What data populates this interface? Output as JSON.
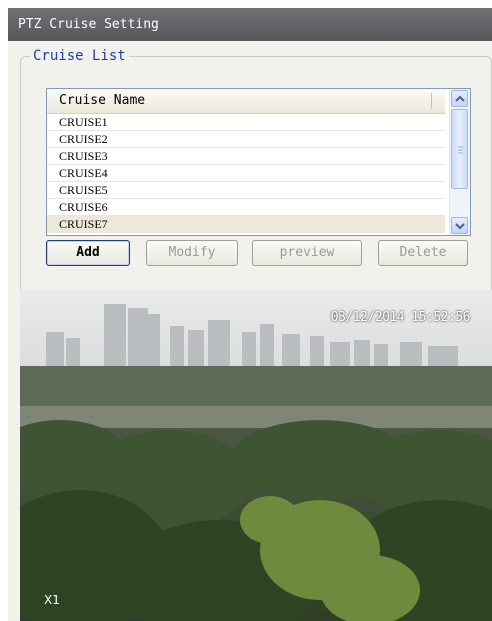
{
  "window": {
    "title": "PTZ Cruise Setting"
  },
  "cruise_list": {
    "legend": "Cruise List",
    "column_header": "Cruise Name",
    "items": [
      "CRUISE1",
      "CRUISE2",
      "CRUISE3",
      "CRUISE4",
      "CRUISE5",
      "CRUISE6",
      "CRUISE7"
    ]
  },
  "buttons": {
    "add": "Add",
    "modify": "Modify",
    "preview": "preview",
    "delete": "Delete"
  },
  "video": {
    "timestamp": "03/12/2014 15:52:56",
    "zoom": "X1"
  }
}
